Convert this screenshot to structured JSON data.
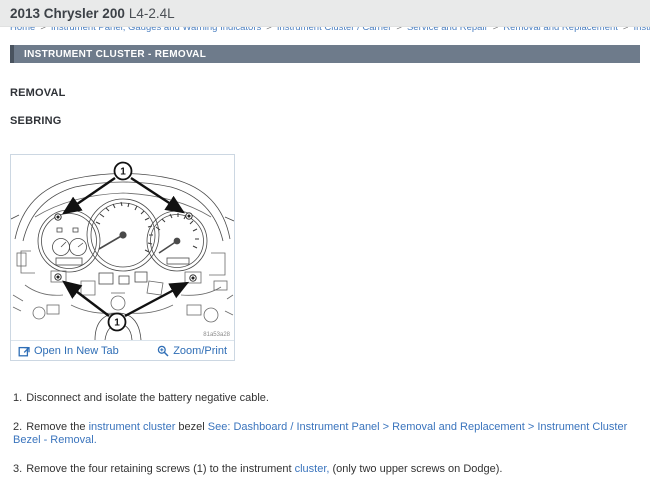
{
  "page": {
    "title_bold": "2013 Chrysler 200",
    "title_engine": "L4-2.4L"
  },
  "breadcrumb": {
    "separator": ">",
    "items": [
      "Home",
      "Instrument Panel, Gauges and Warning Indicators",
      "Instrument Cluster / Carrier",
      "Service and Repair",
      "Removal and Replacement",
      "Instrument Cluster - Removal"
    ]
  },
  "section_header": {
    "label": "INSTRUMENT CLUSTER - REMOVAL"
  },
  "headings": {
    "removal": "REMOVAL",
    "sebring": "SEBRING"
  },
  "figure": {
    "callout_label": "1",
    "figure_code": "81a53a28",
    "open_in_new_tab_label": "Open In New Tab",
    "zoom_print_label": "Zoom/Print"
  },
  "steps": [
    {
      "num": "1.",
      "segments": [
        {
          "text": "Disconnect and isolate the battery negative cable.",
          "link": false
        }
      ]
    },
    {
      "num": "2.",
      "segments": [
        {
          "text": "Remove the ",
          "link": false
        },
        {
          "text": "instrument cluster",
          "link": true
        },
        {
          "text": " bezel ",
          "link": false
        },
        {
          "text": "See: Dashboard / Instrument Panel > Removal and Replacement > Instrument Cluster Bezel - Removal.",
          "link": true
        }
      ]
    },
    {
      "num": "3.",
      "segments": [
        {
          "text": "Remove the four retaining screws (1) to the instrument ",
          "link": false
        },
        {
          "text": "cluster,",
          "link": true
        },
        {
          "text": " (only two upper screws on Dodge).",
          "link": false
        }
      ]
    }
  ],
  "colors": {
    "section_header_bg": "#6e7b8b",
    "section_header_edge": "#49535f",
    "link_blue": "#2f6eb6",
    "top_band": "#e9eaea",
    "panel_border": "#ccd7e2"
  }
}
